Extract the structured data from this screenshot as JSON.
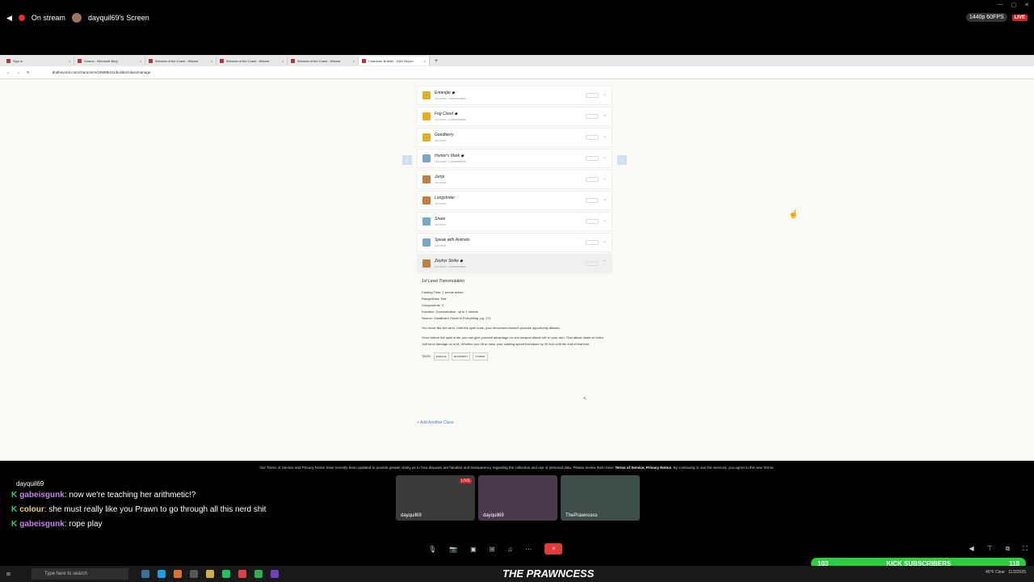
{
  "topbar": {
    "status": "On stream",
    "screen": "dayquil69's Screen",
    "quality": "1440p 60FPS",
    "live": "LIVE"
  },
  "browser": {
    "tabs": [
      {
        "label": "Sign in"
      },
      {
        "label": "Search - Microsoft Bing"
      },
      {
        "label": "Wizards of the Coast - Wizard"
      },
      {
        "label": "Wizards of the Coast - Wizard"
      },
      {
        "label": "Wizards of the Coast - Wizard"
      },
      {
        "label": "Character Builder - D&D Beyon"
      }
    ],
    "url": "dndbeyond.com/characters/155885411/builder/class/manage"
  },
  "spells": [
    {
      "name": "Entangle ◆",
      "sub": "1st Level • Concentration",
      "color": "#e0b020"
    },
    {
      "name": "Fog Cloud ◆",
      "sub": "1st Level • Concentration",
      "color": "#e0b020"
    },
    {
      "name": "Goodberry",
      "sub": "1st Level",
      "color": "#e0b020"
    },
    {
      "name": "Hunter's Mark ◆",
      "sub": "1st Level • Concentration",
      "color": "#7aa6c8"
    },
    {
      "name": "Jump",
      "sub": "1st Level",
      "color": "#c08040"
    },
    {
      "name": "Longstrider",
      "sub": "1st Level",
      "color": "#c08040"
    },
    {
      "name": "Snare",
      "sub": "1st Level",
      "color": "#7aa6c8"
    },
    {
      "name": "Speak with Animals",
      "sub": "1st Level",
      "color": "#7aa6c8"
    },
    {
      "name": "Zephyr Strike ◆",
      "sub": "1st Level • Concentration",
      "color": "#c08040"
    }
  ],
  "detail": {
    "level": "1st Level Transmutation",
    "casting": "Casting Time: 1 bonus action",
    "range": "Range/Area: Self",
    "components": "Components: V",
    "duration": "Duration: Concentration, up to 1 minute",
    "source": "Source: Xanathar's Guide to Everything, pg. 171",
    "p1": "You move like the wind. Until the spell ends, your movement doesn't provoke opportunity attacks.",
    "p2": "Once before the spell ends, you can give yourself advantage on one weapon attack roll on your turn. That attack deals an extra 1d8 force damage on a hit. Whether you hit or miss, your walking speed increases by 30 feet until the end of that turn.",
    "tags_label": "TAGS:",
    "tags": [
      "DAMAGE",
      "MOVEMENT",
      "COMBAT"
    ]
  },
  "add_class": "+ Add Another Class",
  "terms": {
    "text": "Our Terms of Service and Privacy Notice have recently been updated to provide greater clarity as to how disputes are handled and transparency regarding the collection and use of personal data. Please review them here:",
    "links": "Terms of Service, Privacy Notice",
    "tail": "By continuing to use the services, you agree to the new Terms."
  },
  "chat": {
    "streamer": "dayquil69",
    "messages": [
      {
        "user": "gabeisgunk",
        "text": ": now we're teaching her arithmetic!?"
      },
      {
        "user": "colour",
        "text": ": she must really like you Prawn to go through all this nerd shit"
      },
      {
        "user": "gabeisgunk",
        "text": ": rope play"
      }
    ]
  },
  "tiles": [
    {
      "name": "dayquil69",
      "live": "LIVE"
    },
    {
      "name": "dayquil69"
    },
    {
      "name": "ThePrawncess"
    }
  ],
  "goal": {
    "left": "103",
    "label": "KICK SUBSCRIBERS",
    "right": "110"
  },
  "brand": "THE PRAWNCESS",
  "taskbar": {
    "search": "Type here to search",
    "weather": "45°F Clear",
    "date": "11/3/2025"
  }
}
